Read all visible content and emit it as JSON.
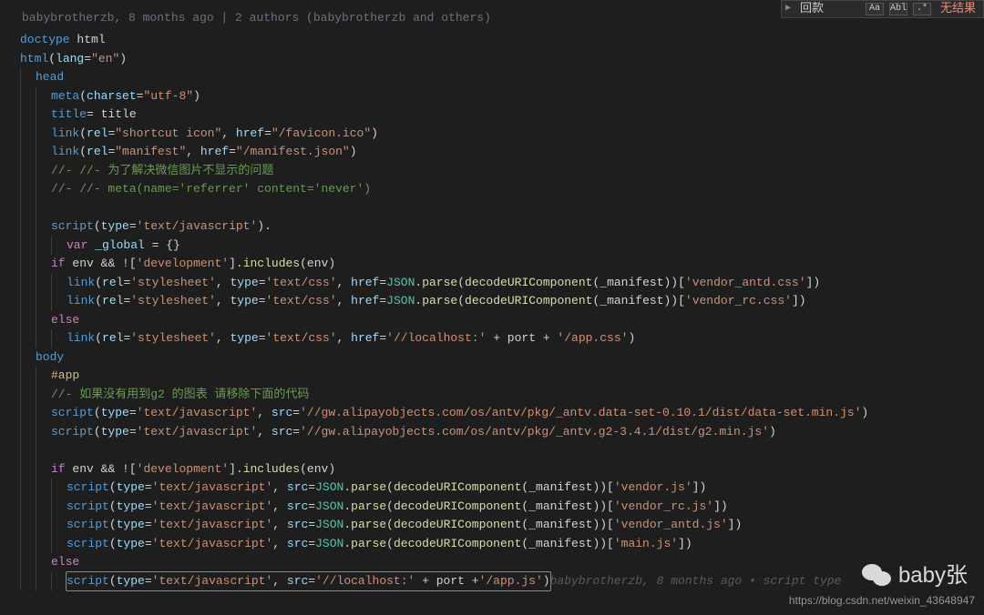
{
  "search": {
    "input": "回款",
    "aa": "Aa",
    "abl": "Abl",
    "regex": ".*",
    "noresult": "无结果"
  },
  "blame": "babybrotherzb, 8 months ago | 2 authors (babybrotherzb and others)",
  "lines": [
    {
      "indent": 0,
      "spans": [
        [
          "c-tag",
          "doctype "
        ],
        [
          "c-white",
          "html"
        ]
      ]
    },
    {
      "indent": 0,
      "spans": [
        [
          "c-tag",
          "html"
        ],
        [
          "c-punc",
          "("
        ],
        [
          "c-attr",
          "lang"
        ],
        [
          "c-punc",
          "="
        ],
        [
          "c-str",
          "\"en\""
        ],
        [
          "c-punc",
          ")"
        ]
      ]
    },
    {
      "indent": 1,
      "spans": [
        [
          "c-tag",
          "head"
        ]
      ]
    },
    {
      "indent": 2,
      "spans": [
        [
          "c-tag",
          "meta"
        ],
        [
          "c-punc",
          "("
        ],
        [
          "c-attr",
          "charset"
        ],
        [
          "c-punc",
          "="
        ],
        [
          "c-str",
          "\"utf-8\""
        ],
        [
          "c-punc",
          ")"
        ]
      ]
    },
    {
      "indent": 2,
      "spans": [
        [
          "c-tag",
          "title"
        ],
        [
          "c-punc",
          "= "
        ],
        [
          "c-white",
          "title"
        ]
      ]
    },
    {
      "indent": 2,
      "spans": [
        [
          "c-tag",
          "link"
        ],
        [
          "c-punc",
          "("
        ],
        [
          "c-attr",
          "rel"
        ],
        [
          "c-punc",
          "="
        ],
        [
          "c-str",
          "\"shortcut icon\""
        ],
        [
          "c-punc",
          ", "
        ],
        [
          "c-attr",
          "href"
        ],
        [
          "c-punc",
          "="
        ],
        [
          "c-str",
          "\"/favicon.ico\""
        ],
        [
          "c-punc",
          ")"
        ]
      ]
    },
    {
      "indent": 2,
      "spans": [
        [
          "c-tag",
          "link"
        ],
        [
          "c-punc",
          "("
        ],
        [
          "c-attr",
          "rel"
        ],
        [
          "c-punc",
          "="
        ],
        [
          "c-str",
          "\"manifest\""
        ],
        [
          "c-punc",
          ", "
        ],
        [
          "c-attr",
          "href"
        ],
        [
          "c-punc",
          "="
        ],
        [
          "c-str",
          "\"/manifest.json\""
        ],
        [
          "c-punc",
          ")"
        ]
      ]
    },
    {
      "indent": 2,
      "spans": [
        [
          "c-cmt",
          "//- //- 为了解决微信图片不显示的问题"
        ]
      ]
    },
    {
      "indent": 2,
      "spans": [
        [
          "c-cmt",
          "//- //- meta(name='referrer' content='never')"
        ]
      ]
    },
    {
      "indent": 2,
      "spans": []
    },
    {
      "indent": 2,
      "spans": [
        [
          "c-tag",
          "script"
        ],
        [
          "c-punc",
          "("
        ],
        [
          "c-attr",
          "type"
        ],
        [
          "c-punc",
          "="
        ],
        [
          "c-str",
          "'text/javascript'"
        ],
        [
          "c-punc",
          ")."
        ]
      ]
    },
    {
      "indent": 3,
      "spans": [
        [
          "c-kw",
          "var "
        ],
        [
          "c-var",
          "_global"
        ],
        [
          "c-punc",
          " = {}"
        ]
      ]
    },
    {
      "indent": 2,
      "spans": [
        [
          "c-kw",
          "if"
        ],
        [
          "c-punc",
          " "
        ],
        [
          "c-white",
          "env "
        ],
        [
          "c-punc",
          "&& !["
        ],
        [
          "c-str",
          "'development'"
        ],
        [
          "c-punc",
          "]."
        ],
        [
          "c-func",
          "includes"
        ],
        [
          "c-punc",
          "("
        ],
        [
          "c-white",
          "env"
        ],
        [
          "c-punc",
          ")"
        ]
      ]
    },
    {
      "indent": 3,
      "spans": [
        [
          "c-tag",
          "link"
        ],
        [
          "c-punc",
          "("
        ],
        [
          "c-attr",
          "rel"
        ],
        [
          "c-punc",
          "="
        ],
        [
          "c-str",
          "'stylesheet'"
        ],
        [
          "c-punc",
          ", "
        ],
        [
          "c-attr",
          "type"
        ],
        [
          "c-punc",
          "="
        ],
        [
          "c-str",
          "'text/css'"
        ],
        [
          "c-punc",
          ", "
        ],
        [
          "c-attr",
          "href"
        ],
        [
          "c-punc",
          "="
        ],
        [
          "c-class",
          "JSON"
        ],
        [
          "c-punc",
          "."
        ],
        [
          "c-func",
          "parse"
        ],
        [
          "c-punc",
          "("
        ],
        [
          "c-func",
          "decodeURIComponent"
        ],
        [
          "c-punc",
          "("
        ],
        [
          "c-white",
          "_manifest"
        ],
        [
          "c-punc",
          "))["
        ],
        [
          "c-str",
          "'vendor_antd.css'"
        ],
        [
          "c-punc",
          "])"
        ]
      ]
    },
    {
      "indent": 3,
      "spans": [
        [
          "c-tag",
          "link"
        ],
        [
          "c-punc",
          "("
        ],
        [
          "c-attr",
          "rel"
        ],
        [
          "c-punc",
          "="
        ],
        [
          "c-str",
          "'stylesheet'"
        ],
        [
          "c-punc",
          ", "
        ],
        [
          "c-attr",
          "type"
        ],
        [
          "c-punc",
          "="
        ],
        [
          "c-str",
          "'text/css'"
        ],
        [
          "c-punc",
          ", "
        ],
        [
          "c-attr",
          "href"
        ],
        [
          "c-punc",
          "="
        ],
        [
          "c-class",
          "JSON"
        ],
        [
          "c-punc",
          "."
        ],
        [
          "c-func",
          "parse"
        ],
        [
          "c-punc",
          "("
        ],
        [
          "c-func",
          "decodeURIComponent"
        ],
        [
          "c-punc",
          "("
        ],
        [
          "c-white",
          "_manifest"
        ],
        [
          "c-punc",
          "))["
        ],
        [
          "c-str",
          "'vendor_rc.css'"
        ],
        [
          "c-punc",
          "])"
        ]
      ]
    },
    {
      "indent": 2,
      "spans": [
        [
          "c-kw",
          "else"
        ]
      ]
    },
    {
      "indent": 3,
      "spans": [
        [
          "c-tag",
          "link"
        ],
        [
          "c-punc",
          "("
        ],
        [
          "c-attr",
          "rel"
        ],
        [
          "c-punc",
          "="
        ],
        [
          "c-str",
          "'stylesheet'"
        ],
        [
          "c-punc",
          ", "
        ],
        [
          "c-attr",
          "type"
        ],
        [
          "c-punc",
          "="
        ],
        [
          "c-str",
          "'text/css'"
        ],
        [
          "c-punc",
          ", "
        ],
        [
          "c-attr",
          "href"
        ],
        [
          "c-punc",
          "="
        ],
        [
          "c-str",
          "'//localhost:'"
        ],
        [
          "c-punc",
          " + "
        ],
        [
          "c-white",
          "port"
        ],
        [
          "c-punc",
          " + "
        ],
        [
          "c-str",
          "'/app.css'"
        ],
        [
          "c-punc",
          ")"
        ]
      ]
    },
    {
      "indent": 1,
      "spans": [
        [
          "c-tag",
          "body"
        ]
      ]
    },
    {
      "indent": 2,
      "spans": [
        [
          "c-sel",
          "#app"
        ]
      ]
    },
    {
      "indent": 2,
      "spans": [
        [
          "c-cmt",
          "//- 如果没有用到g2 的图表 请移除下面的代码"
        ]
      ]
    },
    {
      "indent": 2,
      "spans": [
        [
          "c-tag",
          "script"
        ],
        [
          "c-punc",
          "("
        ],
        [
          "c-attr",
          "type"
        ],
        [
          "c-punc",
          "="
        ],
        [
          "c-str",
          "'text/javascript'"
        ],
        [
          "c-punc",
          ", "
        ],
        [
          "c-attr",
          "src"
        ],
        [
          "c-punc",
          "="
        ],
        [
          "c-str",
          "'//gw.alipayobjects.com/os/antv/pkg/_antv.data-set-0.10.1/dist/data-set.min.js'"
        ],
        [
          "c-punc",
          ")"
        ]
      ]
    },
    {
      "indent": 2,
      "spans": [
        [
          "c-tag",
          "script"
        ],
        [
          "c-punc",
          "("
        ],
        [
          "c-attr",
          "type"
        ],
        [
          "c-punc",
          "="
        ],
        [
          "c-str",
          "'text/javascript'"
        ],
        [
          "c-punc",
          ", "
        ],
        [
          "c-attr",
          "src"
        ],
        [
          "c-punc",
          "="
        ],
        [
          "c-str",
          "'//gw.alipayobjects.com/os/antv/pkg/_antv.g2-3.4.1/dist/g2.min.js'"
        ],
        [
          "c-punc",
          ")"
        ]
      ]
    },
    {
      "indent": 2,
      "spans": []
    },
    {
      "indent": 2,
      "spans": [
        [
          "c-kw",
          "if"
        ],
        [
          "c-punc",
          " "
        ],
        [
          "c-white",
          "env "
        ],
        [
          "c-punc",
          "&& !["
        ],
        [
          "c-str",
          "'development'"
        ],
        [
          "c-punc",
          "]."
        ],
        [
          "c-func",
          "includes"
        ],
        [
          "c-punc",
          "("
        ],
        [
          "c-white",
          "env"
        ],
        [
          "c-punc",
          ")"
        ]
      ]
    },
    {
      "indent": 3,
      "spans": [
        [
          "c-tag",
          "script"
        ],
        [
          "c-punc",
          "("
        ],
        [
          "c-attr",
          "type"
        ],
        [
          "c-punc",
          "="
        ],
        [
          "c-str",
          "'text/javascript'"
        ],
        [
          "c-punc",
          ", "
        ],
        [
          "c-attr",
          "src"
        ],
        [
          "c-punc",
          "="
        ],
        [
          "c-class",
          "JSON"
        ],
        [
          "c-punc",
          "."
        ],
        [
          "c-func",
          "parse"
        ],
        [
          "c-punc",
          "("
        ],
        [
          "c-func",
          "decodeURIComponent"
        ],
        [
          "c-punc",
          "("
        ],
        [
          "c-white",
          "_manifest"
        ],
        [
          "c-punc",
          "))["
        ],
        [
          "c-str",
          "'vendor.js'"
        ],
        [
          "c-punc",
          "])"
        ]
      ]
    },
    {
      "indent": 3,
      "spans": [
        [
          "c-tag",
          "script"
        ],
        [
          "c-punc",
          "("
        ],
        [
          "c-attr",
          "type"
        ],
        [
          "c-punc",
          "="
        ],
        [
          "c-str",
          "'text/javascript'"
        ],
        [
          "c-punc",
          ", "
        ],
        [
          "c-attr",
          "src"
        ],
        [
          "c-punc",
          "="
        ],
        [
          "c-class",
          "JSON"
        ],
        [
          "c-punc",
          "."
        ],
        [
          "c-func",
          "parse"
        ],
        [
          "c-punc",
          "("
        ],
        [
          "c-func",
          "decodeURIComponent"
        ],
        [
          "c-punc",
          "("
        ],
        [
          "c-white",
          "_manifest"
        ],
        [
          "c-punc",
          "))["
        ],
        [
          "c-str",
          "'vendor_rc.js'"
        ],
        [
          "c-punc",
          "])"
        ]
      ]
    },
    {
      "indent": 3,
      "spans": [
        [
          "c-tag",
          "script"
        ],
        [
          "c-punc",
          "("
        ],
        [
          "c-attr",
          "type"
        ],
        [
          "c-punc",
          "="
        ],
        [
          "c-str",
          "'text/javascript'"
        ],
        [
          "c-punc",
          ", "
        ],
        [
          "c-attr",
          "src"
        ],
        [
          "c-punc",
          "="
        ],
        [
          "c-class",
          "JSON"
        ],
        [
          "c-punc",
          "."
        ],
        [
          "c-func",
          "parse"
        ],
        [
          "c-punc",
          "("
        ],
        [
          "c-func",
          "decodeURIComponent"
        ],
        [
          "c-punc",
          "("
        ],
        [
          "c-white",
          "_manifest"
        ],
        [
          "c-punc",
          "))["
        ],
        [
          "c-str",
          "'vendor_antd.js'"
        ],
        [
          "c-punc",
          "])"
        ]
      ]
    },
    {
      "indent": 3,
      "spans": [
        [
          "c-tag",
          "script"
        ],
        [
          "c-punc",
          "("
        ],
        [
          "c-attr",
          "type"
        ],
        [
          "c-punc",
          "="
        ],
        [
          "c-str",
          "'text/javascript'"
        ],
        [
          "c-punc",
          ", "
        ],
        [
          "c-attr",
          "src"
        ],
        [
          "c-punc",
          "="
        ],
        [
          "c-class",
          "JSON"
        ],
        [
          "c-punc",
          "."
        ],
        [
          "c-func",
          "parse"
        ],
        [
          "c-punc",
          "("
        ],
        [
          "c-func",
          "decodeURIComponent"
        ],
        [
          "c-punc",
          "("
        ],
        [
          "c-white",
          "_manifest"
        ],
        [
          "c-punc",
          "))["
        ],
        [
          "c-str",
          "'main.js'"
        ],
        [
          "c-punc",
          "])"
        ]
      ]
    },
    {
      "indent": 2,
      "spans": [
        [
          "c-kw",
          "else"
        ]
      ]
    },
    {
      "indent": 3,
      "cursor": true,
      "spans": [
        [
          "c-tag",
          "script"
        ],
        [
          "c-punc",
          "("
        ],
        [
          "c-attr",
          "type"
        ],
        [
          "c-punc",
          "="
        ],
        [
          "c-str",
          "'text/javascript'"
        ],
        [
          "c-punc",
          ", "
        ],
        [
          "c-attr",
          "src"
        ],
        [
          "c-punc",
          "="
        ],
        [
          "c-str",
          "'//localhost:'"
        ],
        [
          "c-punc",
          " + "
        ],
        [
          "c-white",
          "port"
        ],
        [
          "c-punc",
          " +"
        ],
        [
          "c-str",
          "'/app.js'"
        ],
        [
          "c-punc",
          ")"
        ]
      ],
      "blame": "babybrotherzb, 8 months ago • script type"
    }
  ],
  "watermark": {
    "name": "baby张",
    "url": "https://blog.csdn.net/weixin_43648947"
  }
}
